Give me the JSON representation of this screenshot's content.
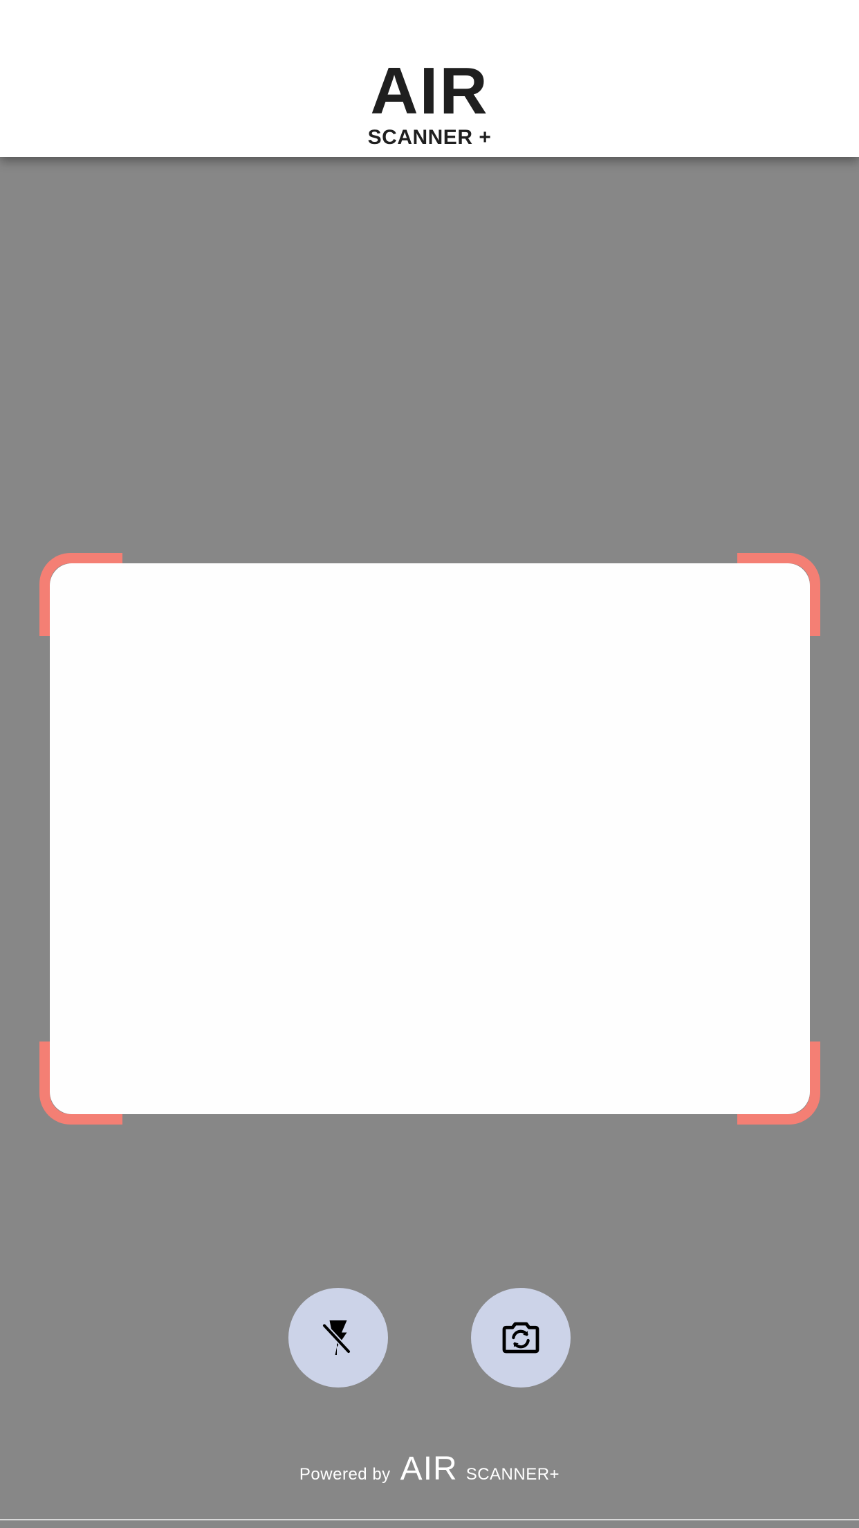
{
  "header": {
    "logo_main": "AIR",
    "logo_sub": "SCANNER +"
  },
  "scanner": {
    "frame_color": "#f47f74",
    "viewfinder_color": "#fefefe"
  },
  "controls": {
    "flash": {
      "icon": "flash-off-icon"
    },
    "flip_camera": {
      "icon": "camera-flip-icon"
    },
    "button_color": "#ccd3e8"
  },
  "footer": {
    "powered_by": "Powered by",
    "brand_main": "AIR",
    "brand_sub": "SCANNER+"
  },
  "colors": {
    "background": "#878787",
    "header": "#ffffff",
    "text_dark": "#1f1f1f",
    "text_light": "#ffffff"
  }
}
